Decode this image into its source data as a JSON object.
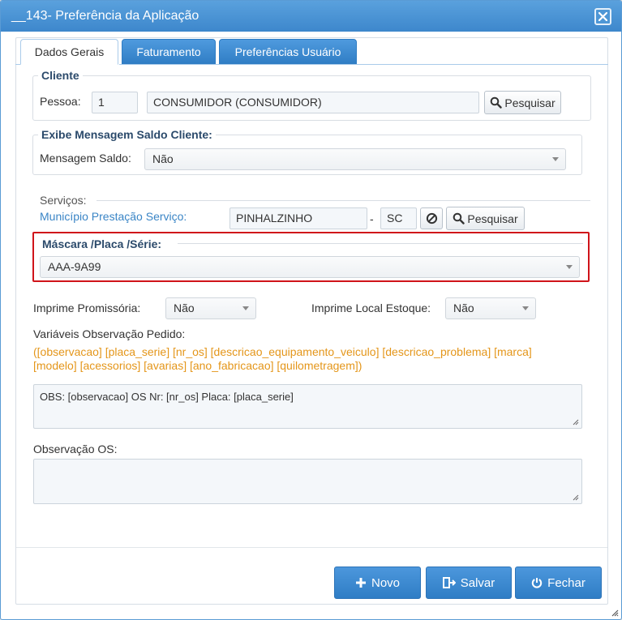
{
  "window": {
    "title": "__143- Preferência da Aplicação"
  },
  "tabs": [
    {
      "label": "Dados Gerais",
      "active": true
    },
    {
      "label": "Faturamento",
      "active": false
    },
    {
      "label": "Preferências Usuário",
      "active": false
    }
  ],
  "cliente": {
    "legend": "Cliente",
    "pessoa_label": "Pessoa:",
    "pessoa_code": "1",
    "pessoa_name": "CONSUMIDOR (CONSUMIDOR)",
    "search_label": "Pesquisar"
  },
  "mensagem": {
    "legend": "Exibe Mensagem Saldo Cliente:",
    "label": "Mensagem Saldo:",
    "value": "Não"
  },
  "servicos": {
    "legend": "Serviços:",
    "municipio_label": "Município Prestação Serviço:",
    "municipio": "PINHALZINHO",
    "separator": "-",
    "uf": "SC",
    "search_label": "Pesquisar"
  },
  "mascara": {
    "label": "Máscara /Placa /Série:",
    "value": "AAA-9A99"
  },
  "promissoria": {
    "label": "Imprime Promissória:",
    "value": "Não"
  },
  "local_estoque": {
    "label": "Imprime Local Estoque:",
    "value": "Não"
  },
  "variaveis": {
    "label": "Variáveis Observação Pedido:",
    "line1": "([observacao] [placa_serie] [nr_os] [descricao_equipamento_veiculo] [descricao_problema] [marca]",
    "line2": "[modelo] [acessorios] [avarias] [ano_fabricacao] [quilometragem])"
  },
  "obs_pedido": {
    "value": "OBS: [observacao] OS Nr: [nr_os]  Placa: [placa_serie]"
  },
  "obs_os": {
    "label": "Observação OS:",
    "value": ""
  },
  "buttons": {
    "novo": "Novo",
    "salvar": "Salvar",
    "fechar": "Fechar"
  },
  "colors": {
    "accent": "#3a85c6",
    "highlight": "#d0141a",
    "variables": "#e4961a"
  }
}
